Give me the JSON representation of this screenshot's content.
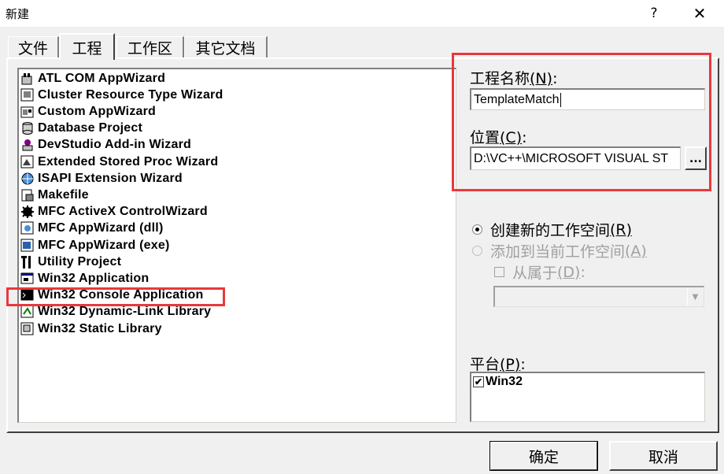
{
  "window": {
    "title": "新建",
    "help_label": "?",
    "close_label": "✕"
  },
  "tabs": [
    {
      "label": "文件",
      "active": false
    },
    {
      "label": "工程",
      "active": true
    },
    {
      "label": "工作区",
      "active": false
    },
    {
      "label": "其它文档",
      "active": false
    }
  ],
  "project_types": [
    {
      "label": "ATL COM AppWizard",
      "icon": "atl-wizard-icon"
    },
    {
      "label": "Cluster Resource Type Wizard",
      "icon": "cluster-wizard-icon"
    },
    {
      "label": "Custom AppWizard",
      "icon": "custom-wizard-icon"
    },
    {
      "label": "Database Project",
      "icon": "database-icon"
    },
    {
      "label": "DevStudio Add-in Wizard",
      "icon": "addin-icon"
    },
    {
      "label": "Extended Stored Proc Wizard",
      "icon": "stored-proc-icon"
    },
    {
      "label": "ISAPI Extension Wizard",
      "icon": "isapi-icon"
    },
    {
      "label": "Makefile",
      "icon": "makefile-icon"
    },
    {
      "label": "MFC ActiveX ControlWizard",
      "icon": "activex-icon"
    },
    {
      "label": "MFC AppWizard (dll)",
      "icon": "mfc-dll-icon"
    },
    {
      "label": "MFC AppWizard (exe)",
      "icon": "mfc-exe-icon"
    },
    {
      "label": "Utility Project",
      "icon": "utility-icon"
    },
    {
      "label": "Win32 Application",
      "icon": "win32-app-icon"
    },
    {
      "label": "Win32 Console Application",
      "icon": "console-icon"
    },
    {
      "label": "Win32 Dynamic-Link Library",
      "icon": "dll-icon"
    },
    {
      "label": "Win32 Static Library",
      "icon": "static-lib-icon"
    }
  ],
  "project_name": {
    "label": "工程名称",
    "mnemonic": "(N)",
    "colon": ":",
    "value": "TemplateMatch"
  },
  "location": {
    "label": "位置",
    "mnemonic": "(C)",
    "colon": ":",
    "value": "D:\\VC++\\MICROSOFT VISUAL ST",
    "browse_label": "..."
  },
  "workspace": {
    "create_new_label": "创建新的工作空间",
    "create_new_mnemonic": "(R)",
    "add_current_label": "添加到当前工作空间",
    "add_current_mnemonic": "(A)",
    "dependency_label": "从属于",
    "dependency_mnemonic": "(D)",
    "dependency_colon": ":",
    "dependency_value": ""
  },
  "platform": {
    "label": "平台",
    "mnemonic": "(P)",
    "colon": ":",
    "items": [
      {
        "label": "Win32",
        "checked": true
      }
    ]
  },
  "buttons": {
    "ok_label": "确定",
    "cancel_label": "取消"
  },
  "colors": {
    "highlight_box": "#e8393d",
    "dialog_face": "#f0f0f0"
  }
}
